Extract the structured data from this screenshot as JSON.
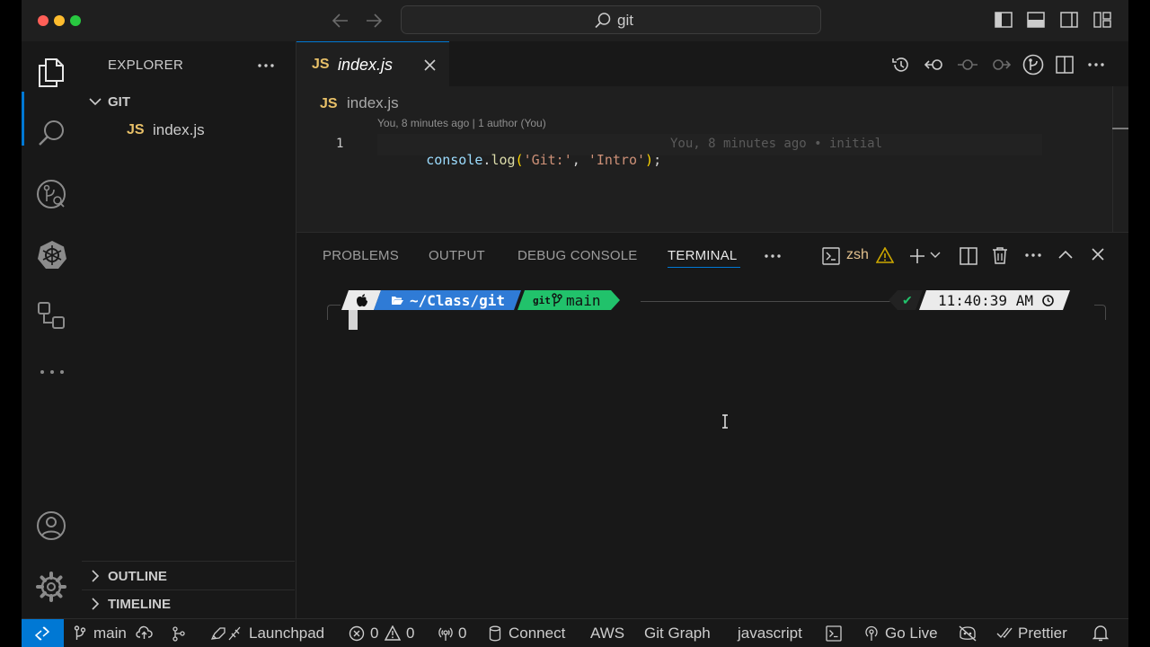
{
  "titlebar": {
    "search_text": "git"
  },
  "sidebar": {
    "title": "EXPLORER",
    "folder": "GIT",
    "files": [
      {
        "badge": "JS",
        "name": "index.js"
      }
    ],
    "outline": "OUTLINE",
    "timeline": "TIMELINE"
  },
  "editor": {
    "tab": {
      "badge": "JS",
      "name": "index.js"
    },
    "breadcrumb": {
      "badge": "JS",
      "name": "index.js"
    },
    "codelens": "You, 8 minutes ago | 1 author (You)",
    "lines": [
      {
        "number": "1",
        "tokens": [
          {
            "text": "console",
            "color": "#9cdcfe"
          },
          {
            "text": ".",
            "color": "#d4d4d4"
          },
          {
            "text": "log",
            "color": "#dcdcaa"
          },
          {
            "text": "(",
            "color": "#ffd700"
          },
          {
            "text": "'Git:'",
            "color": "#ce9178"
          },
          {
            "text": ", ",
            "color": "#d4d4d4"
          },
          {
            "text": "'Intro'",
            "color": "#ce9178"
          },
          {
            "text": ")",
            "color": "#ffd700"
          },
          {
            "text": ";",
            "color": "#d4d4d4"
          }
        ],
        "blame": "You, 8 minutes ago • initial"
      }
    ]
  },
  "panel": {
    "tabs": [
      "PROBLEMS",
      "OUTPUT",
      "DEBUG CONSOLE",
      "TERMINAL"
    ],
    "active_tab": "TERMINAL",
    "shell": "zsh",
    "prompt": {
      "path": "~/Class/git",
      "git_label": "git",
      "branch": "main",
      "status": "✔",
      "time": "11:40:39 AM"
    }
  },
  "statusbar": {
    "branch": "main",
    "launchpad": "Launchpad",
    "errors": "0",
    "warnings": "0",
    "ports": "0",
    "connect": "Connect",
    "aws": "AWS",
    "git_graph": "Git Graph",
    "language": "javascript",
    "go_live": "Go Live",
    "prettier": "Prettier"
  },
  "colors": {
    "accent": "#0078d4",
    "js_yellow": "#e8c068",
    "prompt_blue": "#2f7bd6",
    "prompt_green": "#21c26b",
    "warning": "#cca700",
    "close_red": "#ff5f57",
    "min_yellow": "#febc2e",
    "max_green": "#28c840"
  }
}
